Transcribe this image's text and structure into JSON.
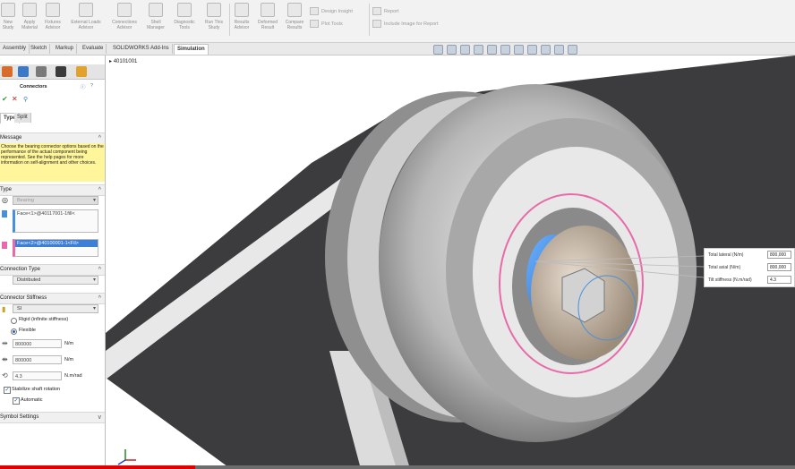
{
  "ribbon": {
    "buttons": [
      {
        "label": "New Study",
        "icon": "new-study-icon"
      },
      {
        "label": "Apply Material",
        "icon": "material-icon"
      },
      {
        "label": "Fixtures Advisor",
        "icon": "fixture-icon"
      },
      {
        "label": "External Loads Advisor",
        "icon": "load-icon"
      },
      {
        "label": "Connections Advisor",
        "icon": "connection-icon"
      },
      {
        "label": "Shell Manager",
        "icon": "shell-icon"
      },
      {
        "label": "Diagnostic Tools",
        "icon": "diagnostic-icon"
      },
      {
        "label": "Run This Study",
        "icon": "run-icon"
      },
      {
        "label": "Results Advisor",
        "icon": "results-icon"
      },
      {
        "label": "Deformed Result",
        "icon": "deformed-icon"
      },
      {
        "label": "Compare Results",
        "icon": "compare-icon"
      }
    ],
    "design_insight": "Design Insight",
    "plot_tools": "Plot Tools",
    "report": "Report",
    "include_image": "Include Image for Report"
  },
  "tabs": [
    {
      "label": "Assembly"
    },
    {
      "label": "Sketch"
    },
    {
      "label": "Markup"
    },
    {
      "label": "Evaluate"
    },
    {
      "label": "SOLIDWORKS Add-Ins"
    },
    {
      "label": "Simulation"
    }
  ],
  "active_tab": "Simulation",
  "tree_root": "40101001",
  "panel": {
    "title": "Connectors",
    "subtabs": [
      "Type",
      "Split"
    ],
    "message_header": "Message",
    "message_text": "Choose the bearing connector options based on the performance of the actual component being represented. See the help pages for more information on self-alignment and other choices.",
    "type_header": "Type",
    "type_value": "Bearing",
    "face1": "Face<1>@40117001-1fill<",
    "face2": "Face<2>@40100001-1<Fil>",
    "connection_type_header": "Connection Type",
    "connection_type_value": "Distributed",
    "stiffness_header": "Connector Stiffness",
    "unit_system": "SI",
    "rigid_label": "Rigid (infinite stiffness)",
    "flexible_label": "Flexible",
    "lateral_value": "800000",
    "lateral_unit": "N/m",
    "axial_value": "800000",
    "axial_unit": "N/m",
    "tilt_value": "4.3",
    "tilt_unit": "N.m/rad",
    "stabilize_label": "Stabilize shaft rotation",
    "automatic_label": "Automatic",
    "symbol_header": "Symbol Settings"
  },
  "callout": {
    "rows": [
      {
        "label": "Total lateral (N/m)",
        "value": "800,000"
      },
      {
        "label": "Total axial (N/m)",
        "value": "800,000"
      },
      {
        "label": "Tilt stiffness (N.m/rad)",
        "value": "4.3"
      }
    ]
  },
  "video_progress": 0.246,
  "colors": {
    "message_bg": "#fff59a",
    "selection_blue": "#4a90d9",
    "selection_pink": "#e86aa8",
    "progress_red": "#e00000"
  }
}
